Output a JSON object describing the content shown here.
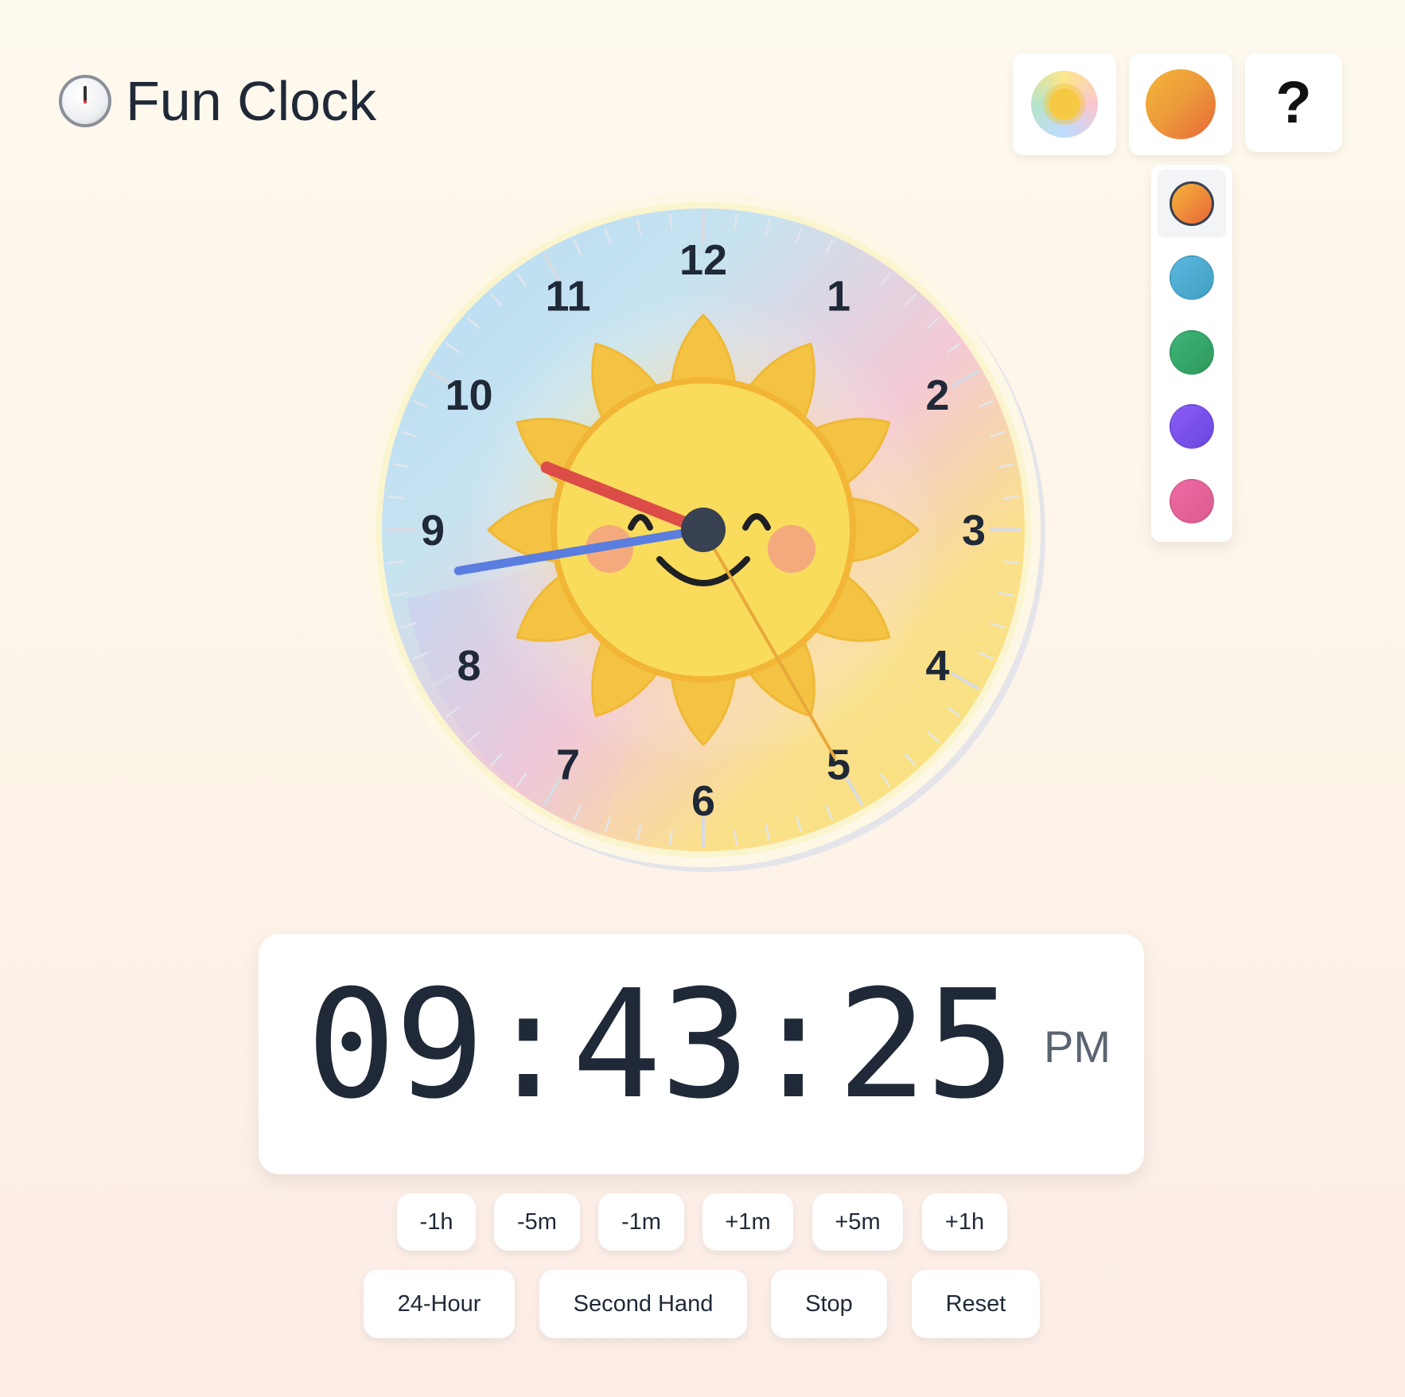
{
  "app": {
    "title": "Fun Clock",
    "title_icon": "clock-icon"
  },
  "toolbar": {
    "theme_button_icon": "sun-theme-icon",
    "color_button_icon": "color-swatch-icon",
    "help_label": "?"
  },
  "colors": {
    "selected": "orange",
    "options": [
      {
        "name": "orange",
        "from": "#f5b53a",
        "to": "#e8663a"
      },
      {
        "name": "blue",
        "from": "#5bb7e0",
        "to": "#40a0c2"
      },
      {
        "name": "green",
        "from": "#3fb47a",
        "to": "#2e9a5a"
      },
      {
        "name": "purple",
        "from": "#8a5cf5",
        "to": "#6a48e0"
      },
      {
        "name": "pink",
        "from": "#f06aa4",
        "to": "#d95c8e"
      }
    ]
  },
  "clock": {
    "numbers": [
      "12",
      "1",
      "2",
      "3",
      "4",
      "5",
      "6",
      "7",
      "8",
      "9",
      "10",
      "11"
    ],
    "hour_hand_color": "#dc4d48",
    "minute_hand_color": "#5a7de0",
    "second_hand_color": "#e8a83a",
    "center_color": "#374151"
  },
  "digital": {
    "time": "09:43:25",
    "ampm": "PM",
    "hours": 9,
    "minutes": 43,
    "seconds": 25
  },
  "adjust_buttons": [
    "-1h",
    "-5m",
    "-1m",
    "+1m",
    "+5m",
    "+1h"
  ],
  "control_buttons": [
    "24-Hour",
    "Second Hand",
    "Stop",
    "Reset"
  ]
}
